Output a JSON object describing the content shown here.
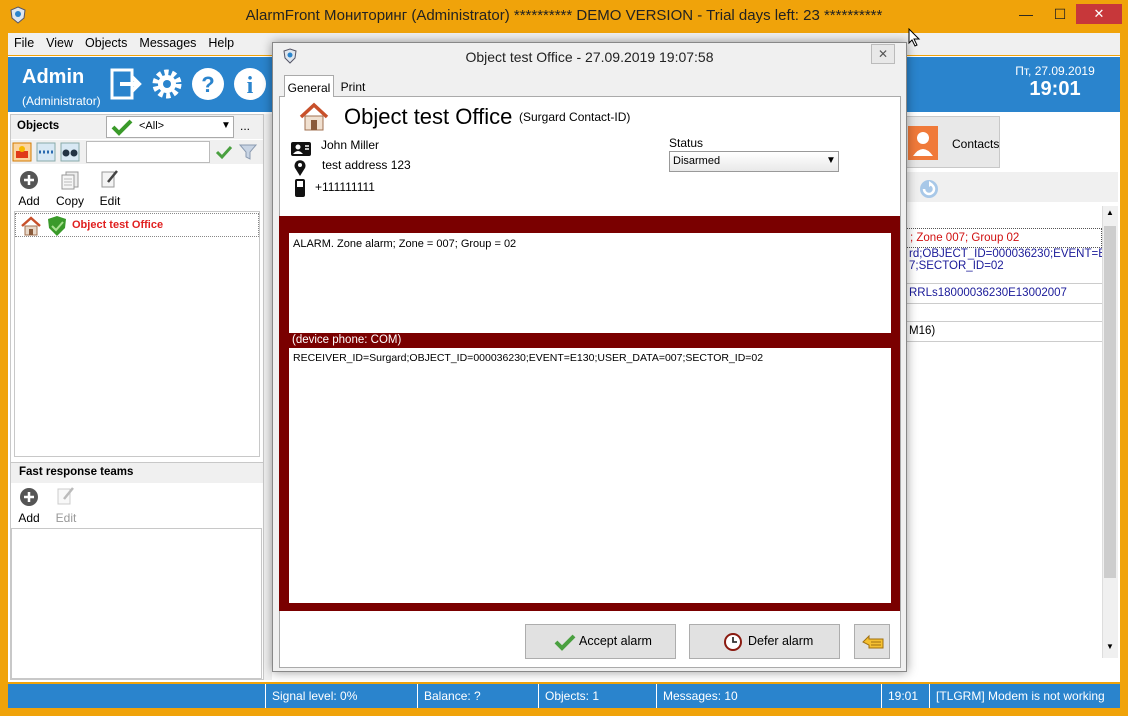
{
  "window": {
    "title": "AlarmFront Мониторинг (Administrator) ********** DEMO VERSION - Trial days left: 23 **********",
    "minimize": "—",
    "maximize": "☐",
    "close": "✕"
  },
  "menu": [
    {
      "label": "File"
    },
    {
      "label": "View"
    },
    {
      "label": "Objects"
    },
    {
      "label": "Messages"
    },
    {
      "label": "Help"
    }
  ],
  "header": {
    "user": "Admin",
    "role": "(Administrator)",
    "date": "Пт, 27.09.2019",
    "time": "19:01"
  },
  "objects_panel": {
    "title": "Objects",
    "filter_value": "<All>",
    "filter_more": "...",
    "tools": {
      "add": "Add",
      "copy": "Copy",
      "edit": "Edit"
    },
    "items": [
      {
        "label": "Object test Office"
      }
    ]
  },
  "frt_panel": {
    "title": "Fast response teams",
    "tools": {
      "add": "Add",
      "edit": "Edit"
    }
  },
  "right_panel": {
    "contacts_tab": "Contacts",
    "rows": [
      "; Zone 007; Group 02",
      "rd;OBJECT_ID=000036230;EVENT=E 7;SECTOR_ID=02",
      "RRLs18000036230E13002007",
      "",
      "M16)"
    ]
  },
  "status_bar": {
    "signal": "Signal level:  0%",
    "balance": "Balance:  ?",
    "objects": "Objects:  1",
    "messages": "Messages:  10",
    "time": "19:01",
    "modem": "[TLGRM] Modem is not working"
  },
  "dialog": {
    "title": "Object test Office - 27.09.2019 19:07:58",
    "close": "✕",
    "tabs": {
      "general": "General",
      "print": "Print"
    },
    "object_name": "Object test Office",
    "object_type": "(Surgard Contact-ID)",
    "owner": "John Miller",
    "address": "test address 123",
    "phone": "+111111111",
    "status_label": "Status",
    "status_value": "Disarmed",
    "alarm_text": "ALARM. Zone alarm; Zone = 007; Group = 02",
    "device_caption": "(device phone: COM)",
    "raw_text": "RECEIVER_ID=Surgard;OBJECT_ID=000036230;EVENT=E130;USER_DATA=007;SECTOR_ID=02",
    "accept": "Accept alarm",
    "defer": "Defer alarm"
  },
  "colors": {
    "window_frame": "#f0a30a",
    "header_blue": "#2a84cd",
    "alarm_frame": "#7a0000",
    "object_label": "#e02020"
  }
}
